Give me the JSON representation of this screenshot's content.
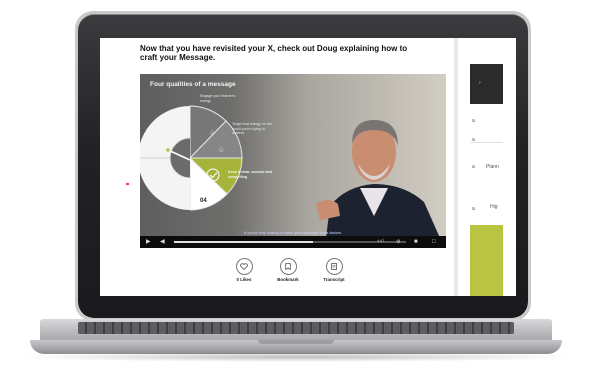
{
  "lesson": {
    "heading": "Now that you have revisited your X, check out Doug explaining how to craft your Message."
  },
  "video": {
    "slide_title": "Four qualities of a message",
    "steps": [
      "Engage your listener's energy",
      "Target that energy on the result you're trying to achieve",
      "Keep it clear, concise and compelling"
    ],
    "step_number": "04",
    "caption": "If you're only looking to make your message those factors.",
    "time": "4:47",
    "progress": 0.6
  },
  "actions": {
    "likes": "0 Likes",
    "bookmark": "Bookmark",
    "transcript": "Transcript"
  },
  "sidebar": {
    "items": [
      "a",
      "a",
      "Plann",
      "a",
      "Hig"
    ]
  },
  "colors": {
    "accent_green": "#b8c442",
    "dark_panel": "#2b2b2c"
  }
}
